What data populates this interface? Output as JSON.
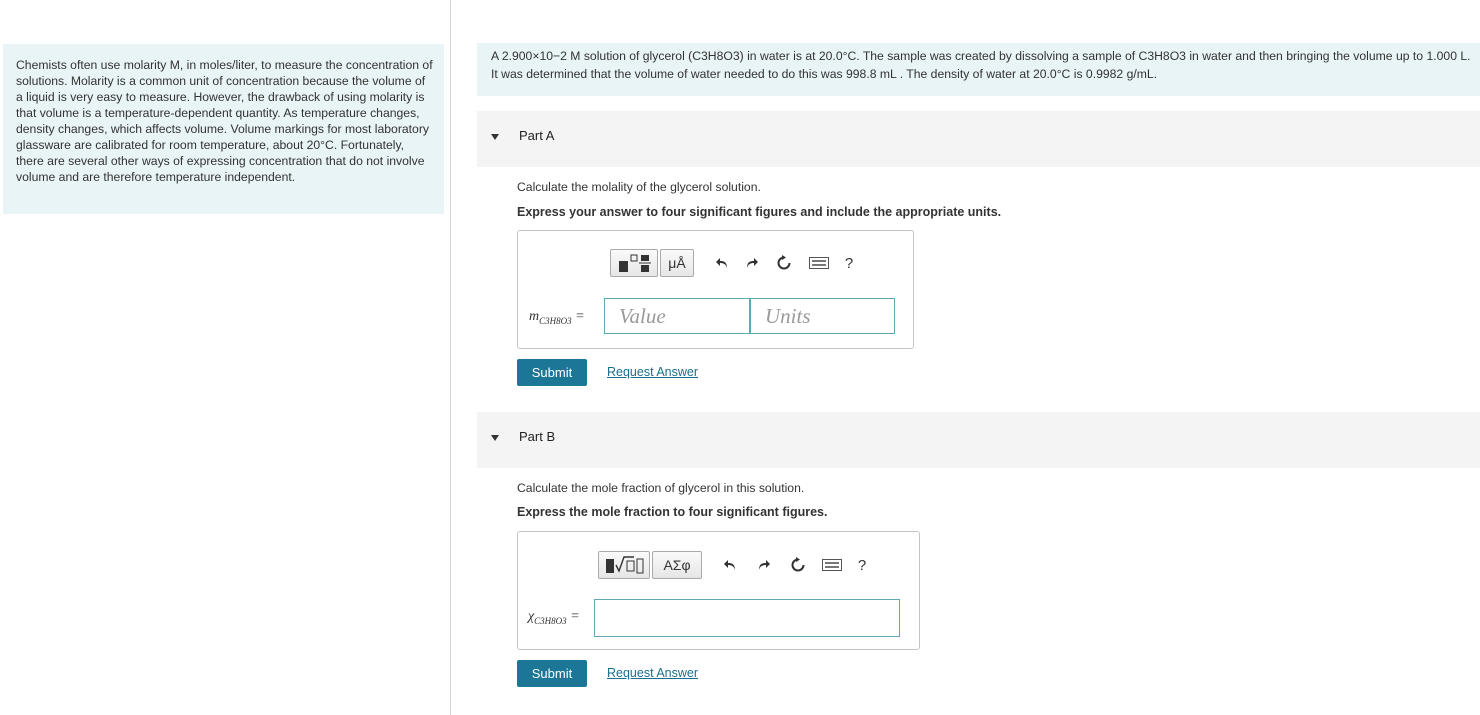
{
  "intro": {
    "text": "Chemists often use molarity M, in moles/liter, to measure the concentration of solutions. Molarity is a common unit of concentration because the volume of a liquid is very easy to measure. However, the drawback of using molarity is that volume is a temperature-dependent quantity. As temperature changes, density changes, which affects volume. Volume markings for most laboratory glassware are calibrated for room temperature, about 20°C. Fortunately, there are several other ways of expressing concentration that do not involve volume and are therefore temperature independent."
  },
  "problem": {
    "text": "A 2.900×10−2 M solution of glycerol (C3H8O3) in water is at 20.0°C. The sample was created by dissolving a sample of C3H8O3 in water and then bringing the volume up to 1.000 L. It was determined that the volume of water needed to do this was 998.8 mL . The density of water at 20.0°C is 0.9982 g/mL."
  },
  "partA": {
    "title": "Part A",
    "question": "Calculate the molality of the glycerol solution.",
    "instruction": "Express your answer to four significant figures and include the appropriate units.",
    "units_button": "μÅ",
    "label": "m",
    "label_sub": "C3H8O3",
    "value_placeholder": "Value",
    "units_placeholder": "Units",
    "submit": "Submit",
    "request": "Request Answer"
  },
  "partB": {
    "title": "Part B",
    "question": "Calculate the mole fraction of glycerol in this solution.",
    "instruction": "Express the mole fraction to four significant figures.",
    "symbols_button": "ΑΣφ",
    "label": "χ",
    "label_sub": "C3H8O3",
    "submit": "Submit",
    "request": "Request Answer"
  },
  "icons": {
    "templates": "templates-icon",
    "units": "units-icon",
    "undo": "undo-icon",
    "redo": "redo-icon",
    "reset": "reset-icon",
    "keyboard": "keyboard-icon",
    "help": "?"
  }
}
